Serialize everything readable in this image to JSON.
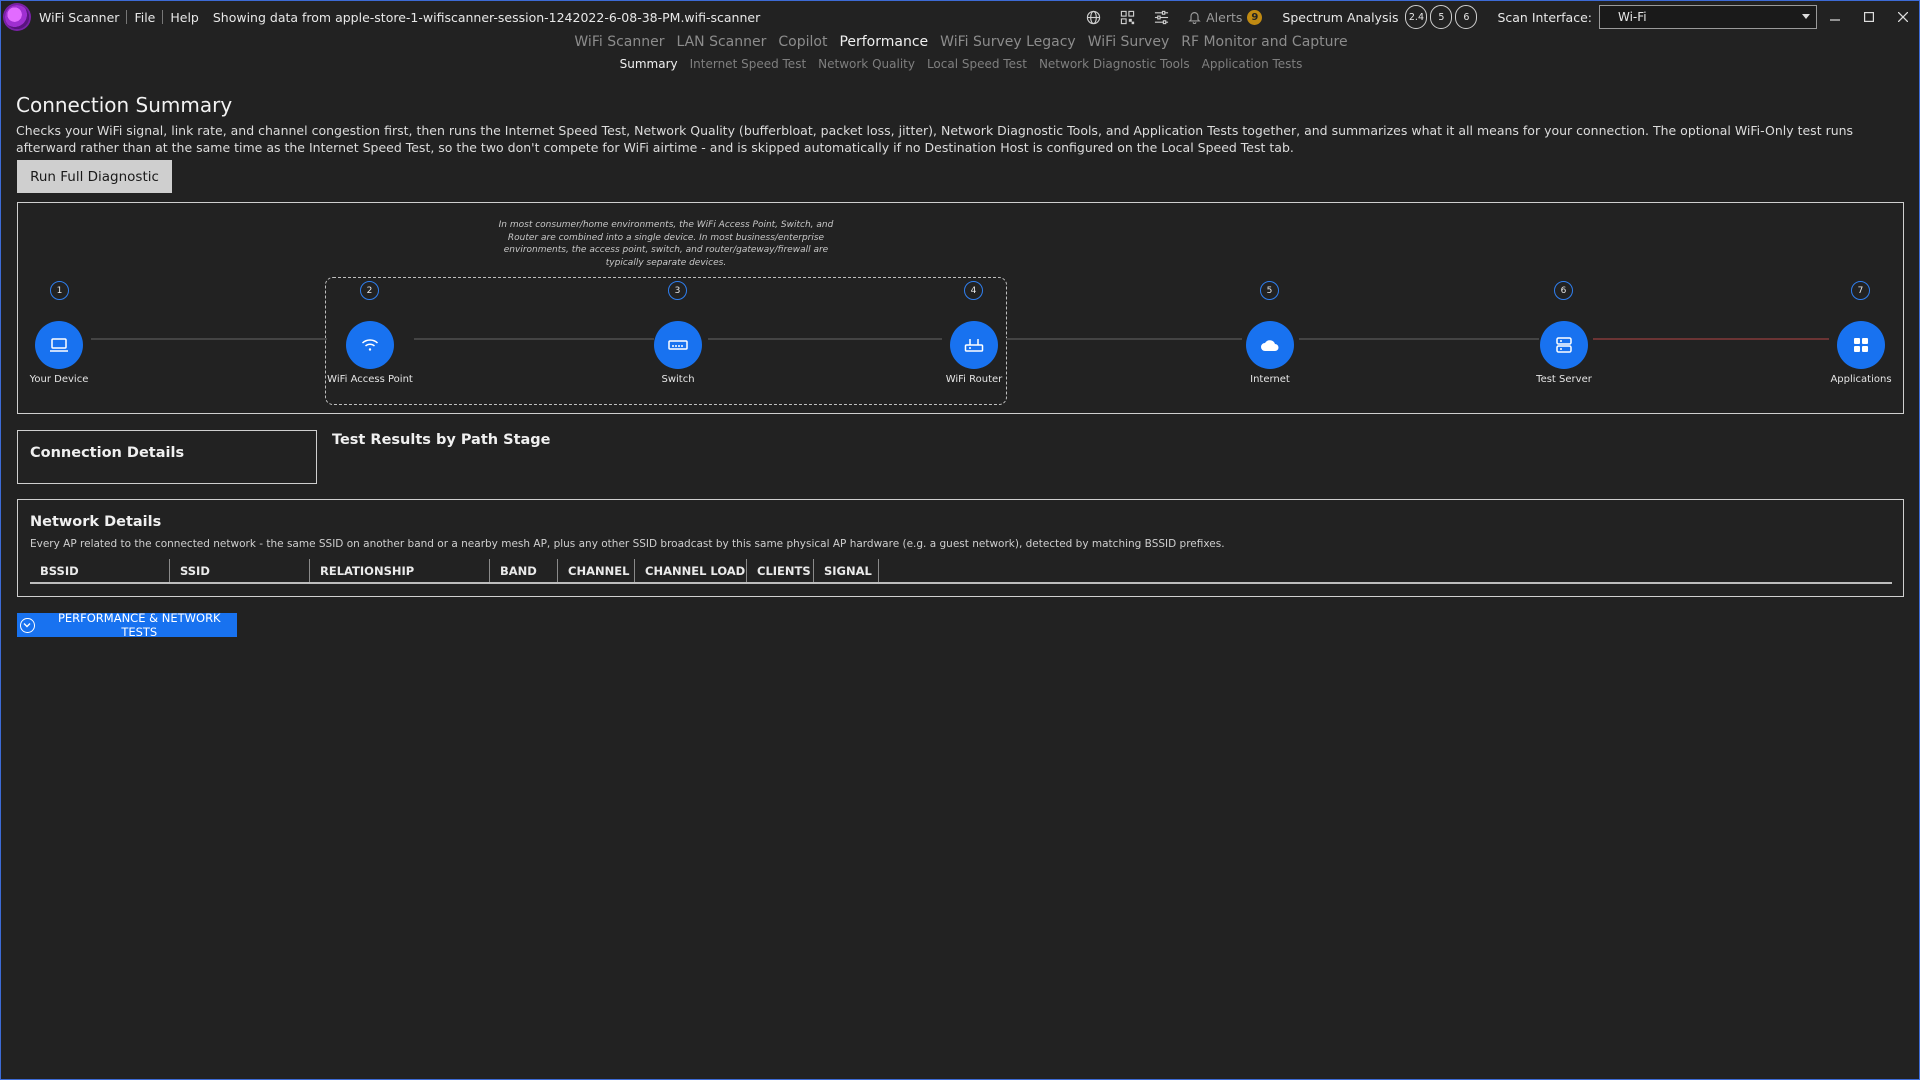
{
  "titlebar": {
    "app_name": "WiFi Scanner",
    "menu": [
      "File",
      "Help"
    ],
    "status": "Showing data from apple-store-1-wifiscanner-session-1242022-6-08-38-PM.wifi-scanner",
    "alerts_label": "Alerts",
    "alerts_count": "9",
    "spectrum_label": "Spectrum Analysis",
    "bands": [
      "2.4",
      "5",
      "6"
    ],
    "scan_label": "Scan Interface:",
    "scan_value": "Wi-Fi"
  },
  "main_tabs": [
    "WiFi Scanner",
    "LAN Scanner",
    "Copilot",
    "Performance",
    "WiFi Survey Legacy",
    "WiFi Survey",
    "RF Monitor and Capture"
  ],
  "active_main_tab": "Performance",
  "sub_tabs": [
    "Summary",
    "Internet Speed Test",
    "Network Quality",
    "Local Speed Test",
    "Network Diagnostic Tools",
    "Application Tests"
  ],
  "active_sub_tab": "Summary",
  "summary": {
    "title": "Connection Summary",
    "description": "Checks your WiFi signal, link rate, and channel congestion first, then runs the Internet Speed Test, Network Quality (bufferbloat, packet loss, jitter), Network Diagnostic Tools, and Application Tests together, and summarizes what it all means for your connection. The optional WiFi-Only test runs afterward rather than at the same time as the Internet Speed Test, so the two don't compete for WiFi airtime - and is skipped automatically if no Destination Host is configured on the Local Speed Test tab.",
    "run_button": "Run Full Diagnostic"
  },
  "path": {
    "note": "In most consumer/home environments, the WiFi Access Point, Switch, and Router are combined into a single device. In most business/enterprise environments, the access point, switch, and router/gateway/firewall are typically separate devices.",
    "stages": [
      {
        "num": "1",
        "label": "Your Device",
        "icon": "laptop-icon"
      },
      {
        "num": "2",
        "label": "WiFi Access Point",
        "icon": "wifi-icon"
      },
      {
        "num": "3",
        "label": "Switch",
        "icon": "switch-icon"
      },
      {
        "num": "4",
        "label": "WiFi Router",
        "icon": "router-icon"
      },
      {
        "num": "5",
        "label": "Internet",
        "icon": "cloud-icon"
      },
      {
        "num": "6",
        "label": "Test Server",
        "icon": "server-icon"
      },
      {
        "num": "7",
        "label": "Applications",
        "icon": "apps-grid-icon"
      }
    ],
    "colors": {
      "node": "#1872f0",
      "link": "#444444",
      "link_warning": "#6b3434"
    }
  },
  "connection_details": {
    "title": "Connection Details"
  },
  "test_results": {
    "title": "Test Results by Path Stage"
  },
  "network_details": {
    "title": "Network Details",
    "description": "Every AP related to the connected network - the same SSID on another band or a nearby mesh AP, plus any other SSID broadcast by this same physical AP hardware (e.g. a guest network), detected by matching BSSID prefixes.",
    "columns": [
      "BSSID",
      "SSID",
      "RELATIONSHIP",
      "BAND",
      "CHANNEL",
      "CHANNEL LOAD",
      "CLIENTS",
      "SIGNAL"
    ]
  },
  "perf_button": "PERFORMANCE & NETWORK TESTS"
}
